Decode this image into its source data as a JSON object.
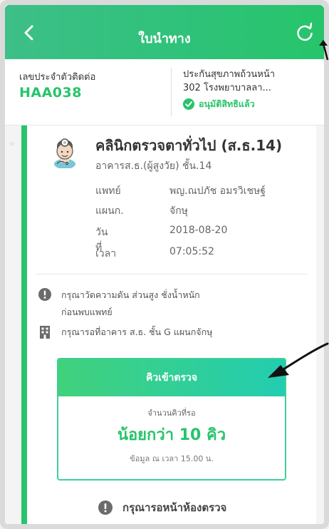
{
  "header": {
    "title": "ใบนำทาง",
    "back_icon": "chevron-left-icon",
    "refresh_icon": "refresh-icon",
    "gradient_start": "#3dbf88",
    "gradient_end": "#27c46b"
  },
  "info": {
    "contact_label": "เลขประจำตัวติดต่อ",
    "contact_code": "HAA038",
    "insurance_line1": "ประกันสุขภาพถ้วนหน้า",
    "insurance_line2": "302 โรงพยาบาลลา...",
    "approved_text": "อนุมัติสิทธิแล้ว",
    "accent_color": "#27c46b"
  },
  "appointment": {
    "clinic_name": "คลินิกตรวจตาทั่วไป (ส.ธ.14)",
    "building": "อาคารส.ธ.(ผู้สูงวัย) ชั้น.14",
    "details": [
      {
        "label": "แพทย์",
        "value": "พญ.ณปภัช อมรวิเชษฐ์"
      },
      {
        "label": "แผนก.",
        "value": "จักษุ"
      },
      {
        "label": "วันที่",
        "value": "2018-08-20"
      },
      {
        "label": "เวลา",
        "value": "07:05:52"
      }
    ],
    "note1_line1": "กรุณาวัดความดัน ส่วนสูง ชั่งน้ำหนัก",
    "note1_line2": "ก่อนพบแพทย์",
    "note2": "กรุณารอที่อาคาร ส.ธ. ชั้น G แผนกจักษุ"
  },
  "queue": {
    "header": "คิวเข้าตรวจ",
    "waiting_label": "จำนวนคิวที่รอ",
    "count_text": "น้อยกว่า 10 คิว",
    "time_text": "ข้อมูล ณ เวลา 15.00 น."
  },
  "footer_note": "กรุณารอหน้าห้องตรวจ"
}
